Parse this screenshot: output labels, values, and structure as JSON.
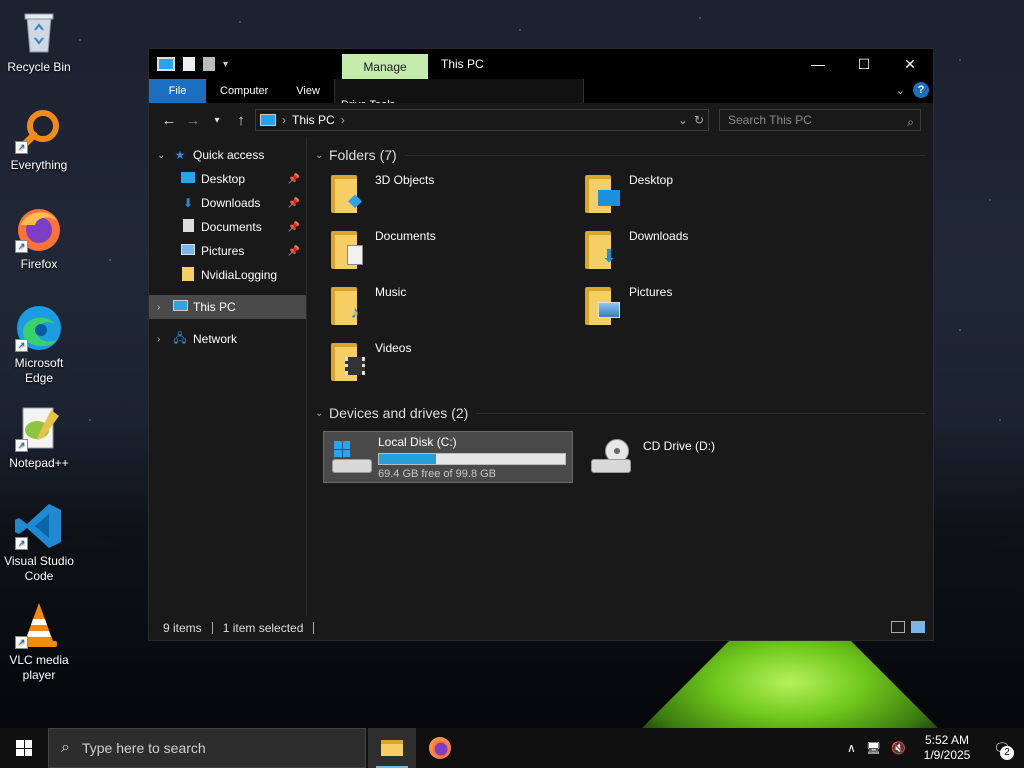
{
  "desktop": {
    "icons": [
      {
        "label": "Recycle Bin",
        "icon": "recycle-bin-icon"
      },
      {
        "label": "Everything",
        "icon": "everything-search-icon"
      },
      {
        "label": "Firefox",
        "icon": "firefox-icon"
      },
      {
        "label": "Microsoft Edge",
        "icon": "edge-icon"
      },
      {
        "label": "Notepad++",
        "icon": "notepadpp-icon"
      },
      {
        "label": "Visual Studio Code",
        "icon": "vscode-icon"
      },
      {
        "label": "VLC media player",
        "icon": "vlc-icon"
      }
    ]
  },
  "window": {
    "title": "This PC",
    "contextual_tab": "Manage",
    "ribbon_tabs": [
      "File",
      "Computer",
      "View",
      "Drive Tools"
    ],
    "address": {
      "segments": [
        "This PC"
      ]
    },
    "search": {
      "placeholder": "Search This PC"
    },
    "nav": {
      "quick_access": "Quick access",
      "quick_items": [
        "Desktop",
        "Downloads",
        "Documents",
        "Pictures",
        "NvidiaLogging"
      ],
      "this_pc": "This PC",
      "network": "Network"
    },
    "folders_group": "Folders (7)",
    "folders": [
      {
        "name": "3D Objects",
        "icon": "3d-objects-icon"
      },
      {
        "name": "Desktop",
        "icon": "desktop-folder-icon"
      },
      {
        "name": "Documents",
        "icon": "documents-folder-icon"
      },
      {
        "name": "Downloads",
        "icon": "downloads-folder-icon"
      },
      {
        "name": "Music",
        "icon": "music-folder-icon"
      },
      {
        "name": "Pictures",
        "icon": "pictures-folder-icon"
      },
      {
        "name": "Videos",
        "icon": "videos-folder-icon"
      }
    ],
    "drives_group": "Devices and drives (2)",
    "drives": [
      {
        "name": "Local Disk (C:)",
        "free_text": "69.4 GB free of 99.8 GB",
        "used_fraction": 0.305
      },
      {
        "name": "CD Drive (D:)"
      }
    ],
    "status": {
      "items": "9 items",
      "selected": "1 item selected"
    }
  },
  "taskbar": {
    "search_placeholder": "Type here to search",
    "time": "5:52 AM",
    "date": "1/9/2025",
    "notifications": "2"
  },
  "colors": {
    "accent": "#1a6fc0",
    "manage_tab": "#c5ebad",
    "progress": "#26a0da"
  }
}
